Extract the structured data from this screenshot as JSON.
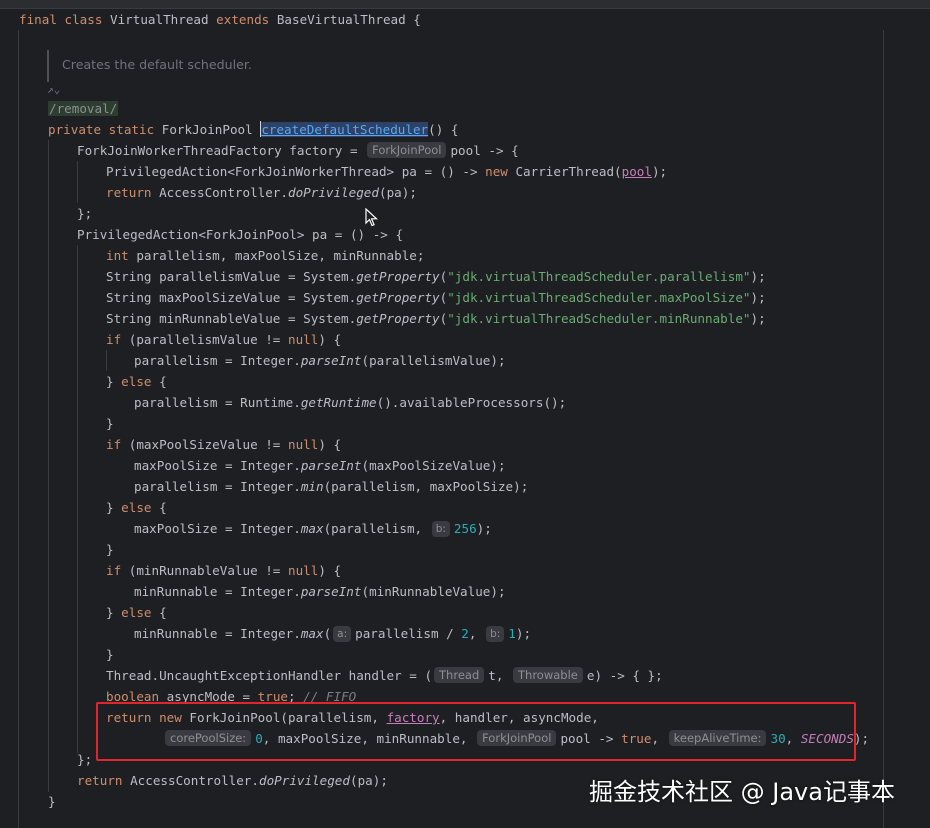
{
  "editor": {
    "class_decl": {
      "kw": "final class ",
      "name": "VirtualThread ",
      "kw2": "extends ",
      "base": "BaseVirtualThread {"
    },
    "doc_comment": "Creates the default scheduler.",
    "removal_tag": "/removal/",
    "method_sig": {
      "kw": "private static ",
      "type": "ForkJoinPool ",
      "name": "createDefaultScheduler",
      "rest": "() {"
    },
    "lines": {
      "l6a": "ForkJoinWorkerThreadFactory factory = ",
      "l6hint": "ForkJoinPool",
      "l6b": "pool -> {",
      "l7a": "PrivilegedAction<ForkJoinWorkerThread> pa = () -> ",
      "l7kw": "new ",
      "l7b": "CarrierThread(",
      "l7pool": "pool",
      "l7c": ");",
      "l8kw": "return ",
      "l8a": "AccessController.",
      "l8m": "doPrivileged",
      "l8b": "(pa);",
      "l9": "};",
      "l10": "PrivilegedAction<ForkJoinPool> pa = () -> {",
      "l11kw": "int ",
      "l11": "parallelism, maxPoolSize, minRunnable;",
      "l12a": "String parallelismValue = System.",
      "l12m": "getProperty",
      "l12s": "\"jdk.virtualThreadScheduler.parallelism\"",
      "l13a": "String maxPoolSizeValue = System.",
      "l13s": "\"jdk.virtualThreadScheduler.maxPoolSize\"",
      "l14a": "String minRunnableValue = System.",
      "l14s": "\"jdk.virtualThreadScheduler.minRunnable\"",
      "if_kw": "if ",
      "null_kw": "null",
      "else_kw": "else ",
      "l15": "(parallelismValue != ",
      "l16a": "parallelism = Integer.",
      "parseInt": "parseInt",
      "l16b": "(parallelismValue);",
      "l17a": "} ",
      "l18a": "parallelism = Runtime.",
      "l18m": "getRuntime",
      "l18b": "().availableProcessors();",
      "close": "}",
      "l20": "(maxPoolSizeValue != ",
      "l21a": "maxPoolSize = Integer.",
      "l21b": "(maxPoolSizeValue);",
      "l22a": "parallelism = Integer.",
      "min": "min",
      "l22b": "(parallelism, maxPoolSize);",
      "max": "max",
      "l24a": "maxPoolSize = Integer.",
      "l24b": "(parallelism, ",
      "hint_b": "b:",
      "hint_a": "a:",
      "n256": "256",
      "l24c": ");",
      "l26": "(minRunnableValue != ",
      "l27a": "minRunnable = Integer.",
      "l27b": "(minRunnableValue);",
      "l29a": "minRunnable = Integer.",
      "l29b": "(",
      "l29c": "parallelism / ",
      "n2": "2",
      "l29d": ", ",
      "n1": "1",
      "l31a": "Thread.UncaughtExceptionHandler handler = (",
      "hint_thread": "Thread",
      "l31b": "t, ",
      "hint_throwable": "Throwable",
      "l31c": "e) -> { };",
      "l32kw": "boolean ",
      "l32a": "asyncMode = ",
      "true_kw": "true",
      "l32b": "; ",
      "l32c": "// FIFO",
      "ret_kw": "return ",
      "new_kw": "new ",
      "l33a": "ForkJoinPool(parallelism, ",
      "factory": "factory",
      "l33b": ", handler, asyncMode,",
      "hint_core": "corePoolSize:",
      "n0": "0",
      "l34a": ", maxPoolSize, minRunnable, ",
      "hint_fjp": "ForkJoinPool",
      "l34b": "pool -> ",
      "l34c": ", ",
      "hint_keep": "keepAliveTime:",
      "n30": "30",
      "l34d": ", ",
      "seconds": "SECONDS",
      "l34e": ");",
      "l35": "};",
      "l36a": "AccessController.",
      "l36b": "(pa);",
      "l37": "}"
    }
  },
  "watermark": "掘金技术社区 @ Java记事本"
}
